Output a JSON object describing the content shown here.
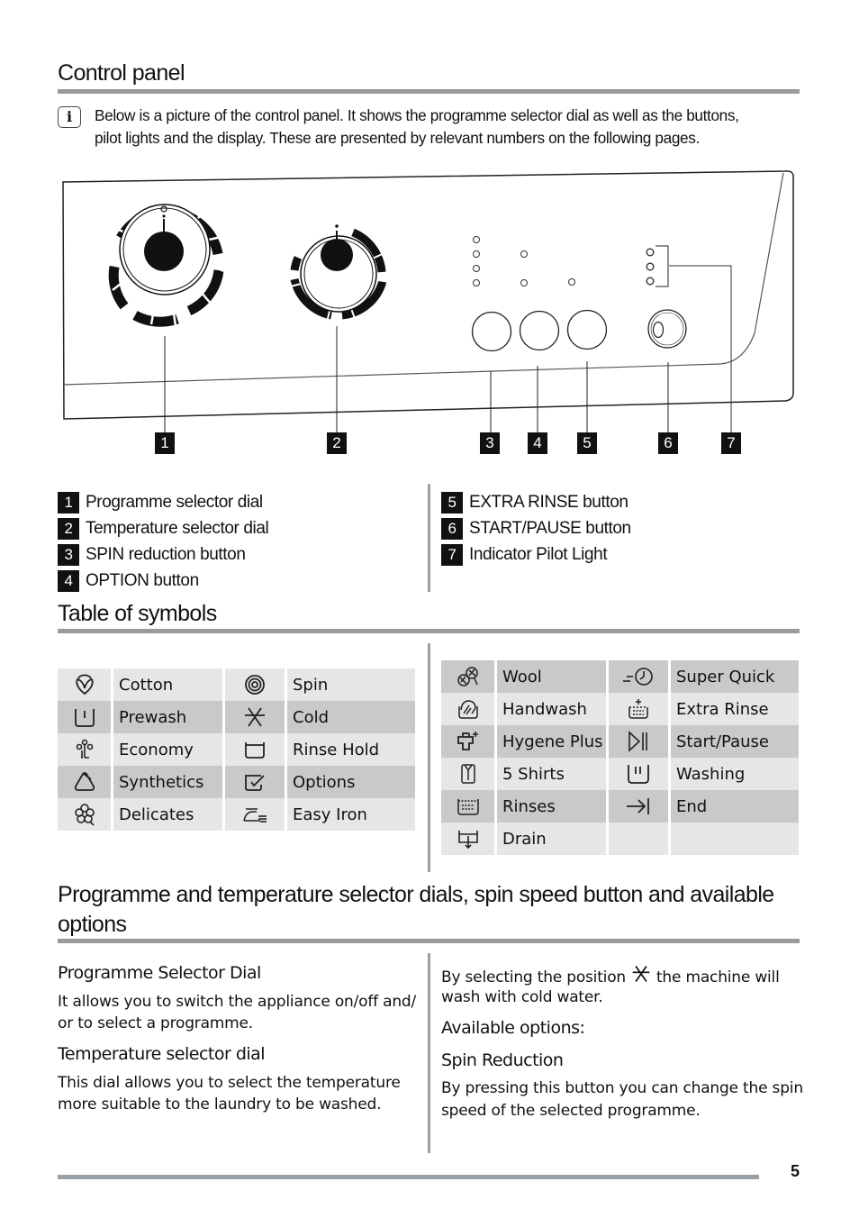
{
  "control_panel": {
    "title": "Control panel",
    "info_icon": "info-icon",
    "intro_line1": "Below is a picture of the control panel. It shows the programme selector dial as well as the buttons,",
    "intro_line2": "pilot lights and the display. These are presented by relevant numbers on the following pages.",
    "diagram_markers": [
      "1",
      "2",
      "3",
      "4",
      "5",
      "6",
      "7"
    ],
    "legend": [
      {
        "num": "1",
        "label": "Programme selector dial"
      },
      {
        "num": "2",
        "label": "Temperature selector dial"
      },
      {
        "num": "3",
        "label": "SPIN reduction button"
      },
      {
        "num": "4",
        "label": "OPTION button"
      },
      {
        "num": "5",
        "label": "EXTRA RINSE button"
      },
      {
        "num": "6",
        "label": "START/PAUSE button"
      },
      {
        "num": "7",
        "label": "Indicator Pilot Light"
      }
    ]
  },
  "symbols": {
    "title": "Table of symbols",
    "left_table": [
      [
        {
          "icon": "cotton-icon",
          "label": "Cotton"
        },
        {
          "icon": "spin-icon",
          "label": "Spin"
        }
      ],
      [
        {
          "icon": "prewash-icon",
          "label": "Prewash"
        },
        {
          "icon": "cold-icon",
          "label": "Cold"
        }
      ],
      [
        {
          "icon": "economy-icon",
          "label": "Economy"
        },
        {
          "icon": "rinse-hold-icon",
          "label": "Rinse Hold"
        }
      ],
      [
        {
          "icon": "synthetics-icon",
          "label": "Synthetics"
        },
        {
          "icon": "options-icon",
          "label": "Options"
        }
      ],
      [
        {
          "icon": "delicates-icon",
          "label": "Delicates"
        },
        {
          "icon": "easy-iron-icon",
          "label": "Easy Iron"
        }
      ]
    ],
    "right_table": [
      [
        {
          "icon": "wool-icon",
          "label": "Wool"
        },
        {
          "icon": "super-quick-icon",
          "label": "Super Quick"
        }
      ],
      [
        {
          "icon": "handwash-icon",
          "label": "Handwash"
        },
        {
          "icon": "extra-rinse-icon",
          "label": "Extra Rinse"
        }
      ],
      [
        {
          "icon": "hygiene-plus-icon",
          "label": "Hygene Plus"
        },
        {
          "icon": "start-pause-icon",
          "label": "Start/Pause"
        }
      ],
      [
        {
          "icon": "shirts-icon",
          "label": "5 Shirts"
        },
        {
          "icon": "washing-icon",
          "label": "Washing"
        }
      ],
      [
        {
          "icon": "rinses-icon",
          "label": "Rinses"
        },
        {
          "icon": "end-icon",
          "label": "End"
        }
      ],
      [
        {
          "icon": "drain-icon",
          "label": "Drain"
        },
        {
          "icon": "",
          "label": ""
        }
      ]
    ]
  },
  "dials_section": {
    "title_line1": "Programme and temperature selector dials, spin speed button and available",
    "title_line2": "options",
    "programme_dial": {
      "heading": "Programme Selector Dial",
      "text_line1": "It allows you to switch the appliance on/off and/",
      "text_line2": "or to select a programme."
    },
    "temperature_dial": {
      "heading": "Temperature selector dial",
      "text_line1": "This dial allows you to select the temperature",
      "text_line2": "more suitable to the laundry to be washed."
    },
    "cold_note": {
      "text_before": "By selecting the position",
      "icon": "cold-icon",
      "text_after": "the machine will",
      "text_line2": "wash with cold water."
    },
    "available_options": "Available options:",
    "spin_reduction": {
      "heading": "Spin Reduction",
      "text_line1": "By pressing this button you can change the spin",
      "text_line2": "speed of the selected programme."
    }
  },
  "footer": {
    "page_number": "5"
  }
}
